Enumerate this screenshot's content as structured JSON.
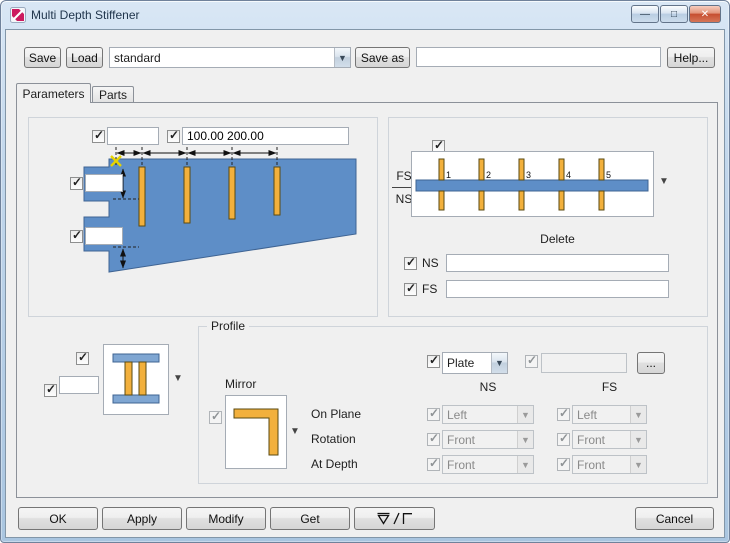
{
  "window": {
    "title": "Multi Depth Stiffener"
  },
  "toolbar": {
    "save": "Save",
    "load": "Load",
    "preset": "standard",
    "save_as": "Save as",
    "save_as_value": "",
    "help": "Help..."
  },
  "tabs": {
    "parameters": "Parameters",
    "parts": "Parts"
  },
  "geometry": {
    "count_value": "",
    "spacing_value": "100.00 200.00",
    "top_offset_value": "",
    "bottom_offset_value": ""
  },
  "sides": {
    "fs_label": "FS",
    "ns_label": "NS",
    "stiffener_numbers": [
      "1",
      "2",
      "3",
      "4",
      "5"
    ],
    "delete_title": "Delete",
    "delete_ns_label": "NS",
    "delete_ns_value": "",
    "delete_fs_label": "FS",
    "delete_fs_value": ""
  },
  "profile": {
    "title": "Profile",
    "size_value": "",
    "mirror_label": "Mirror",
    "on_plane_label": "On Plane",
    "rotation_label": "Rotation",
    "at_depth_label": "At Depth",
    "type_value": "Plate",
    "name_value": "",
    "browse_label": "...",
    "ns_header": "NS",
    "fs_header": "FS",
    "ns_on_plane": "Left",
    "ns_rotation": "Front",
    "ns_at_depth": "Front",
    "fs_on_plane": "Left",
    "fs_rotation": "Front",
    "fs_at_depth": "Front"
  },
  "footer": {
    "ok": "OK",
    "apply": "Apply",
    "modify": "Modify",
    "get": "Get",
    "cancel": "Cancel",
    "toggle_icon": "field-switch-toggle-icon"
  },
  "colors": {
    "plate_blue": "#5E8EC7",
    "stiffener_yellow": "#F2B03C",
    "titlebar_blue": "#BBD2E9"
  }
}
